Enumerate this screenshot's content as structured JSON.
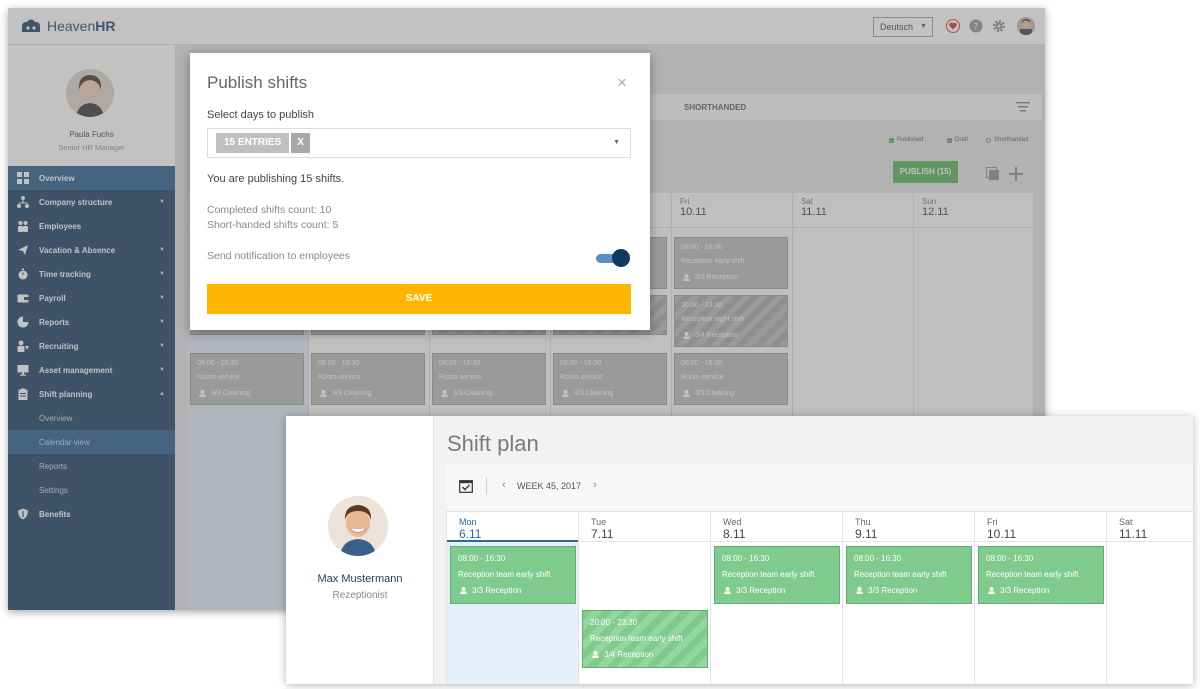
{
  "app": {
    "logo_light": "Heaven",
    "logo_bold": "HR",
    "language": "Deutsch"
  },
  "profile": {
    "name": "Paula Fuchs",
    "role": "Senior HR Manager"
  },
  "sidebar": {
    "items": [
      {
        "label": "Overview",
        "icon": "grid-icon"
      },
      {
        "label": "Company structure",
        "icon": "org-chart-icon"
      },
      {
        "label": "Employees",
        "icon": "people-icon"
      },
      {
        "label": "Vacation & Absence",
        "icon": "plane-icon"
      },
      {
        "label": "Time tracking",
        "icon": "stopwatch-icon"
      },
      {
        "label": "Payroll",
        "icon": "wallet-icon"
      },
      {
        "label": "Reports",
        "icon": "pie-chart-icon"
      },
      {
        "label": "Recruiting",
        "icon": "recruit-icon"
      },
      {
        "label": "Asset management",
        "icon": "monitor-icon"
      },
      {
        "label": "Shift planning",
        "icon": "clipboard-icon"
      }
    ],
    "subitems": [
      "Overview",
      "Calendar view",
      "Reports",
      "Settings"
    ],
    "benefits": "Benefits"
  },
  "back_calendar": {
    "tab": "SHORTHANDED",
    "legend": [
      "Published",
      "Draft",
      "Shorthanded"
    ],
    "publish_button": "PUBLISH (15)",
    "days": [
      {
        "name": "Fri",
        "date": "10.11"
      },
      {
        "name": "Sat",
        "date": "11.11"
      },
      {
        "name": "Sun",
        "date": "12.11"
      }
    ],
    "fri_shifts": [
      {
        "time": "08:00 - 16:30",
        "name": "Reception early shift",
        "count": "3/3 Reception"
      },
      {
        "time": "20:00 - 23:30",
        "name": "Reception night shift",
        "count": "3/4 Reception"
      }
    ],
    "room_service": {
      "time": "08:00 - 16:30",
      "name": "Room service",
      "count": "3/3 Cleaning"
    }
  },
  "modal": {
    "title": "Publish shifts",
    "close": "×",
    "select_label": "Select days to publish",
    "chip": "15 ENTRIES",
    "chip_remove": "X",
    "info": "You are publishing 15 shifts.",
    "completed": "Completed shifts count: 10",
    "shorthanded": "Short-handed shifts count: 5",
    "notify_label": "Send notification to employees",
    "notify_on": true,
    "save": "SAVE"
  },
  "front": {
    "user_name": "Max Mustermann",
    "user_role": "Rezeptionist",
    "title": "Shift plan",
    "week": "WEEK 45, 2017",
    "days": [
      {
        "name": "Mon",
        "date": "6.11"
      },
      {
        "name": "Tue",
        "date": "7.11"
      },
      {
        "name": "Wed",
        "date": "8.11"
      },
      {
        "name": "Thu",
        "date": "9.11"
      },
      {
        "name": "Fri",
        "date": "10.11"
      },
      {
        "name": "Sat",
        "date": "11.11"
      }
    ],
    "early_shift": {
      "time": "08:00 - 16:30",
      "name": "Reception team early shift",
      "count": "3/3 Reception"
    },
    "tue_shift": {
      "time": "20:00 - 23:30",
      "name": "Reception team early shift",
      "count": "3/4 Reception"
    }
  },
  "colors": {
    "sidebar": "#10365a",
    "accent_blue": "#2a69a4",
    "shift_green": "#7ecb8d",
    "save_yellow": "#ffb600",
    "publish_green": "#4caf50"
  }
}
